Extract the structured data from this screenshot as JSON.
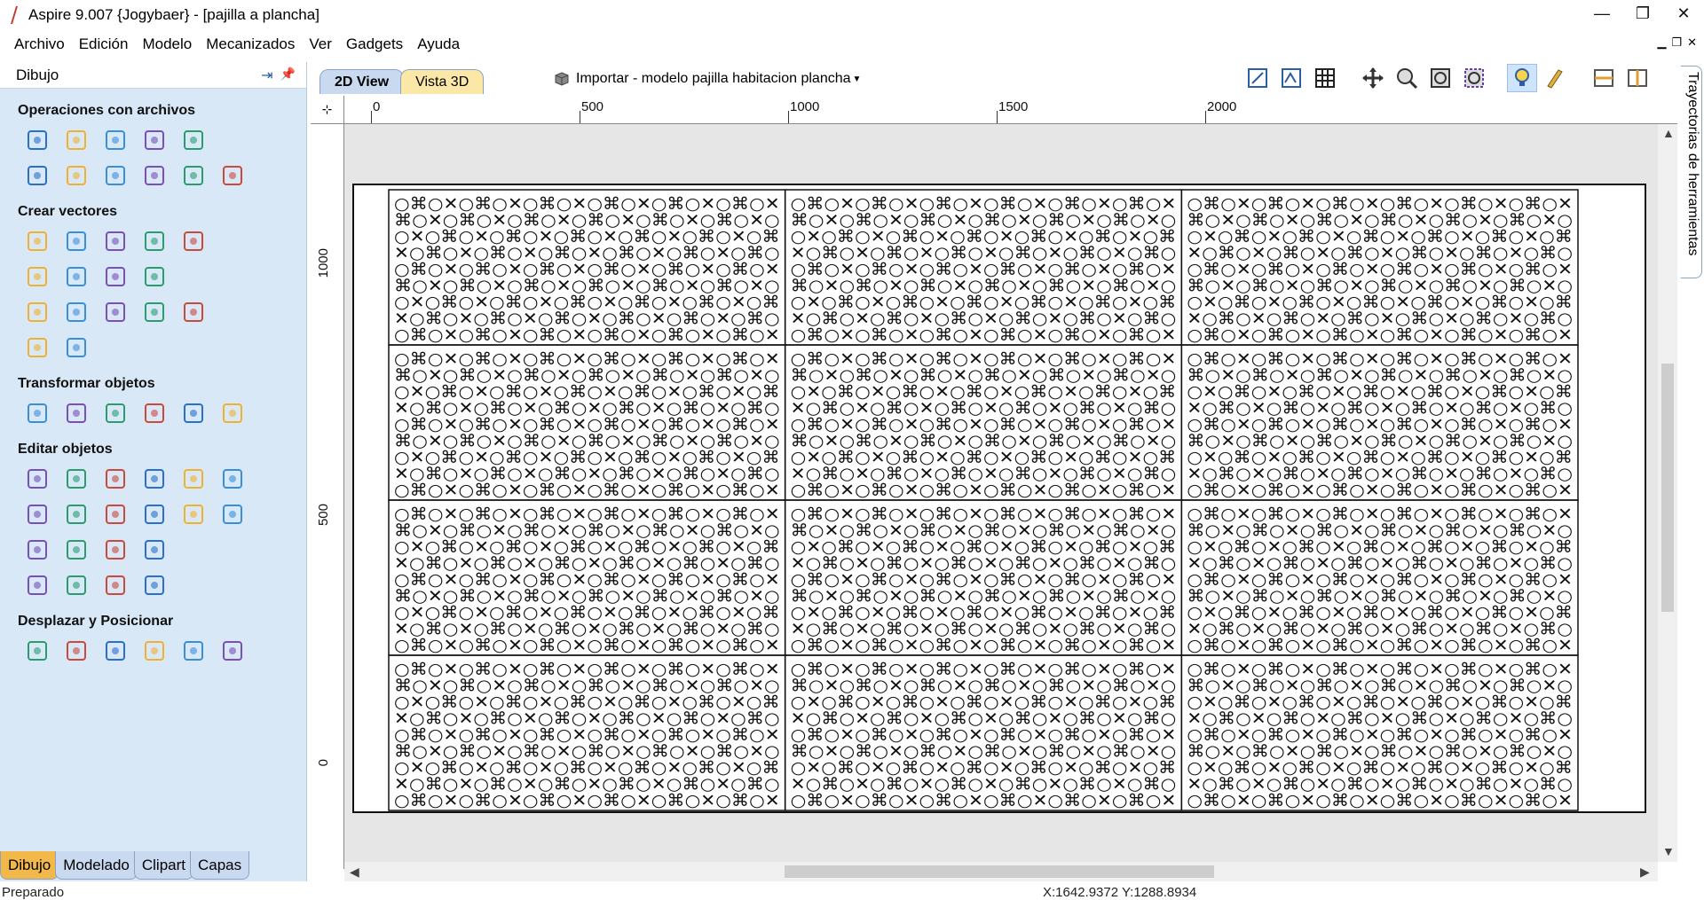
{
  "window": {
    "title": "Aspire 9.007 {Jogybaer} - [pajilla a plancha]",
    "controls": [
      "—",
      "❐",
      "✕"
    ]
  },
  "menu": [
    "Archivo",
    "Edición",
    "Modelo",
    "Mecanizados",
    "Ver",
    "Gadgets",
    "Ayuda"
  ],
  "view_tabs": [
    "2D View",
    "Vista 3D"
  ],
  "import_label": "Importar - modelo pajilla habitacion plancha",
  "panel": {
    "title": "Dibujo",
    "sections": [
      {
        "title": "Operaciones con archivos",
        "rows": [
          [
            "new-file-icon",
            "open-folder-icon",
            "save-icon",
            "open-project-icon",
            "import-icon"
          ],
          [
            "select-all-icon",
            "cut-icon",
            "copy-icon",
            "paste-icon",
            "undo-icon",
            "redo-icon"
          ]
        ]
      },
      {
        "title": "Crear vectores",
        "rows": [
          [
            "circle-icon",
            "ellipse-icon",
            "rectangle-icon",
            "polygon-icon",
            "star-icon"
          ],
          [
            "polyline-icon",
            "curve-icon",
            "s-curve-icon",
            "spiral-icon"
          ],
          [
            "text-icon",
            "text-box-icon",
            "text-on-curve-icon",
            "text-arc-icon",
            "text-abc-icon"
          ],
          [
            "drill-icon",
            "dimension-icon"
          ]
        ]
      },
      {
        "title": "Transformar objetos",
        "rows": [
          [
            "move-icon",
            "scale-icon",
            "align-icon",
            "mirror-icon",
            "distort-icon",
            "center-icon"
          ]
        ]
      },
      {
        "title": "Editar objetos",
        "rows": [
          [
            "select-icon",
            "node-edit-icon",
            "interactive-select-icon",
            "group-icon",
            "ungroup-icon",
            "measure-icon"
          ],
          [
            "weld-icon",
            "merge-icon",
            "trim-icon",
            "offset-icon",
            "scissors-icon",
            "fillet-icon"
          ],
          [
            "angle-icon",
            "join-icon",
            "smooth-icon",
            "extend-icon"
          ],
          [
            "close-icon",
            "fit-arc-icon",
            "curve-fit-icon",
            "bezier-icon"
          ]
        ]
      },
      {
        "title": "Desplazar y Posicionar",
        "rows": [
          [
            "nest-icon",
            "array-icon",
            "rotate-copy-icon",
            "path-copy-icon",
            "grid-copy-icon",
            "step-repeat-icon"
          ]
        ]
      }
    ]
  },
  "bottom_tabs": [
    "Dibujo",
    "Modelado",
    "Clipart",
    "Capas"
  ],
  "right_tab": "Trayectorias de herramientas",
  "rulers": {
    "top": [
      "0",
      "500",
      "1000",
      "1500",
      "2000"
    ],
    "left": [
      "1000",
      "500",
      "0"
    ]
  },
  "status": {
    "text": "Preparado",
    "coords": "X:1642.9372 Y:1288.8934"
  },
  "pattern": {
    "cols": 3,
    "rows": 4,
    "glyph_rows_per_panel": 9,
    "glyphs": [
      "○",
      "⌘",
      "○",
      "✕"
    ]
  }
}
